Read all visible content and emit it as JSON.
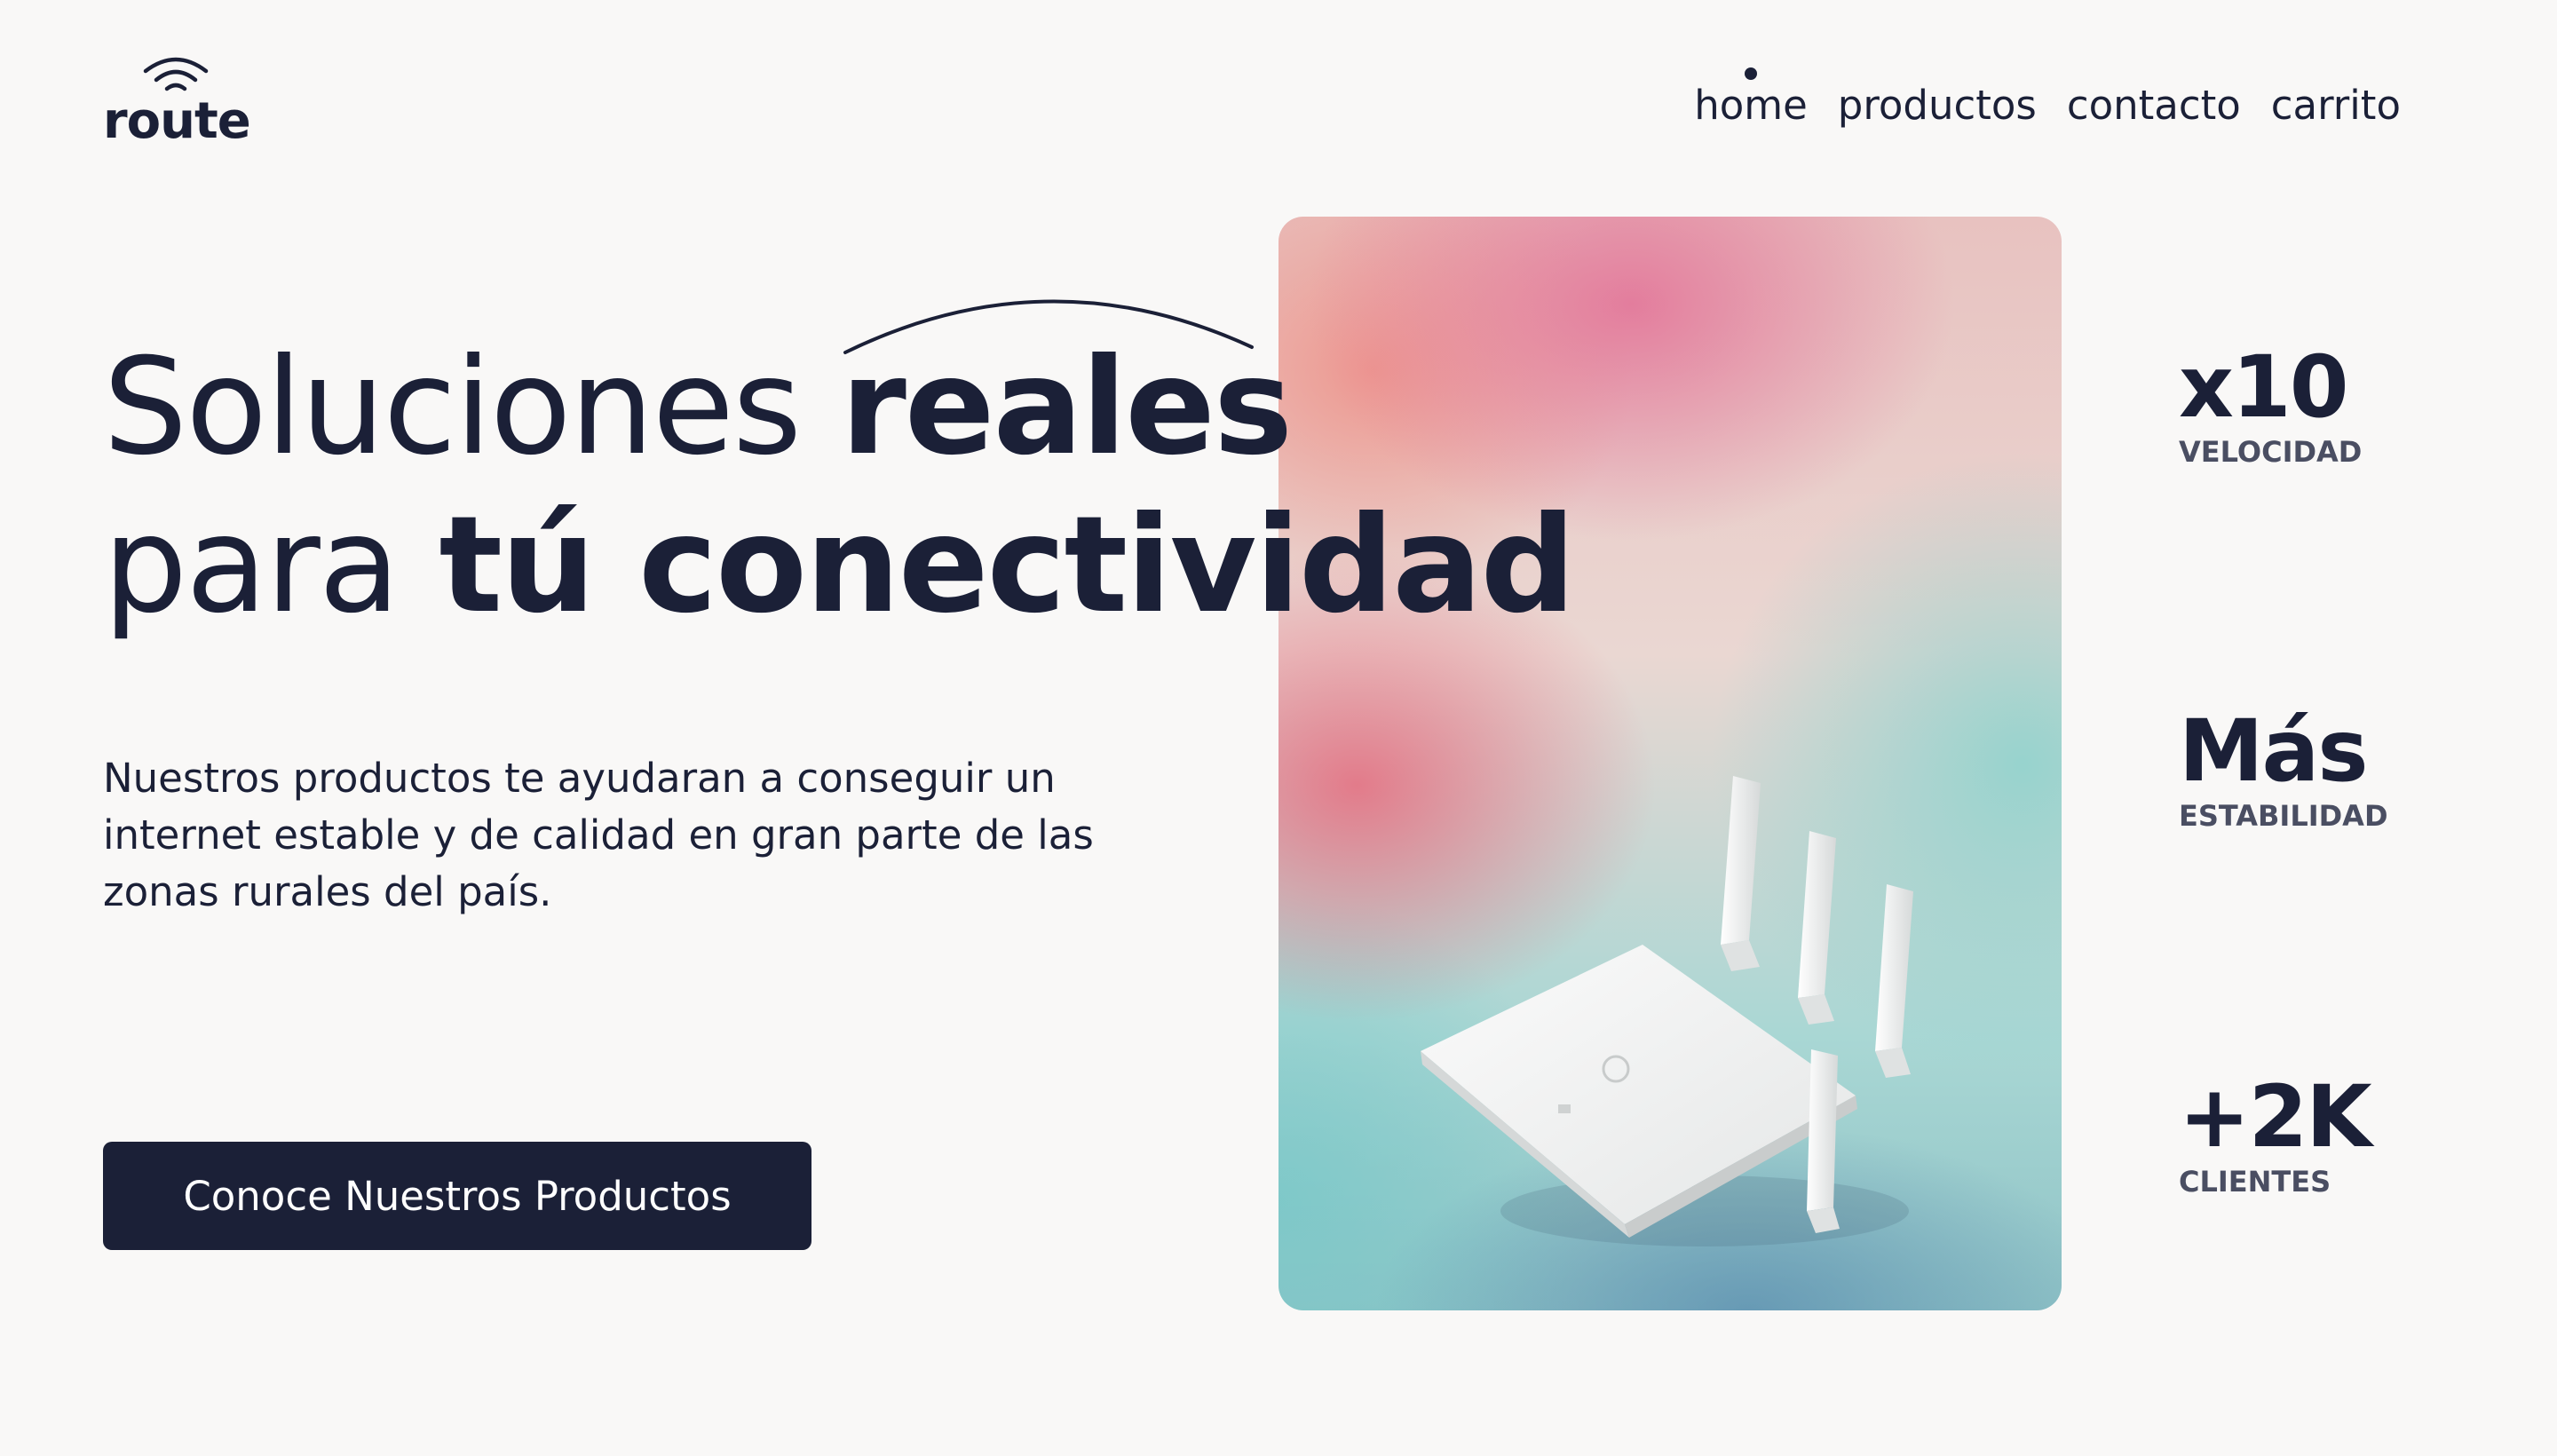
{
  "header": {
    "logo_text": "route",
    "nav": [
      {
        "label": "home",
        "active": true
      },
      {
        "label": "productos",
        "active": false
      },
      {
        "label": "contacto",
        "active": false
      },
      {
        "label": "carrito",
        "active": false
      }
    ]
  },
  "hero": {
    "title_line1_regular": "Soluciones ",
    "title_line1_bold": "reales",
    "title_line2_regular": "para ",
    "title_line2_bold": "tú conectividad",
    "description": "Nuestros productos te ayudaran a conseguir un internet estable y de calidad en gran parte de las zonas rurales del país.",
    "cta_label": "Conoce Nuestros Productos"
  },
  "stats": [
    {
      "value": "x10",
      "label": "VELOCIDAD"
    },
    {
      "value": "Más",
      "label": "ESTABILIDAD"
    },
    {
      "value": "+2K",
      "label": "CLIENTES"
    }
  ],
  "colors": {
    "primary": "#1b2037",
    "background": "#f9f8f7",
    "label": "#4a4e62"
  },
  "icons": {
    "logo": "wifi-signal-icon",
    "product": "router-image"
  }
}
